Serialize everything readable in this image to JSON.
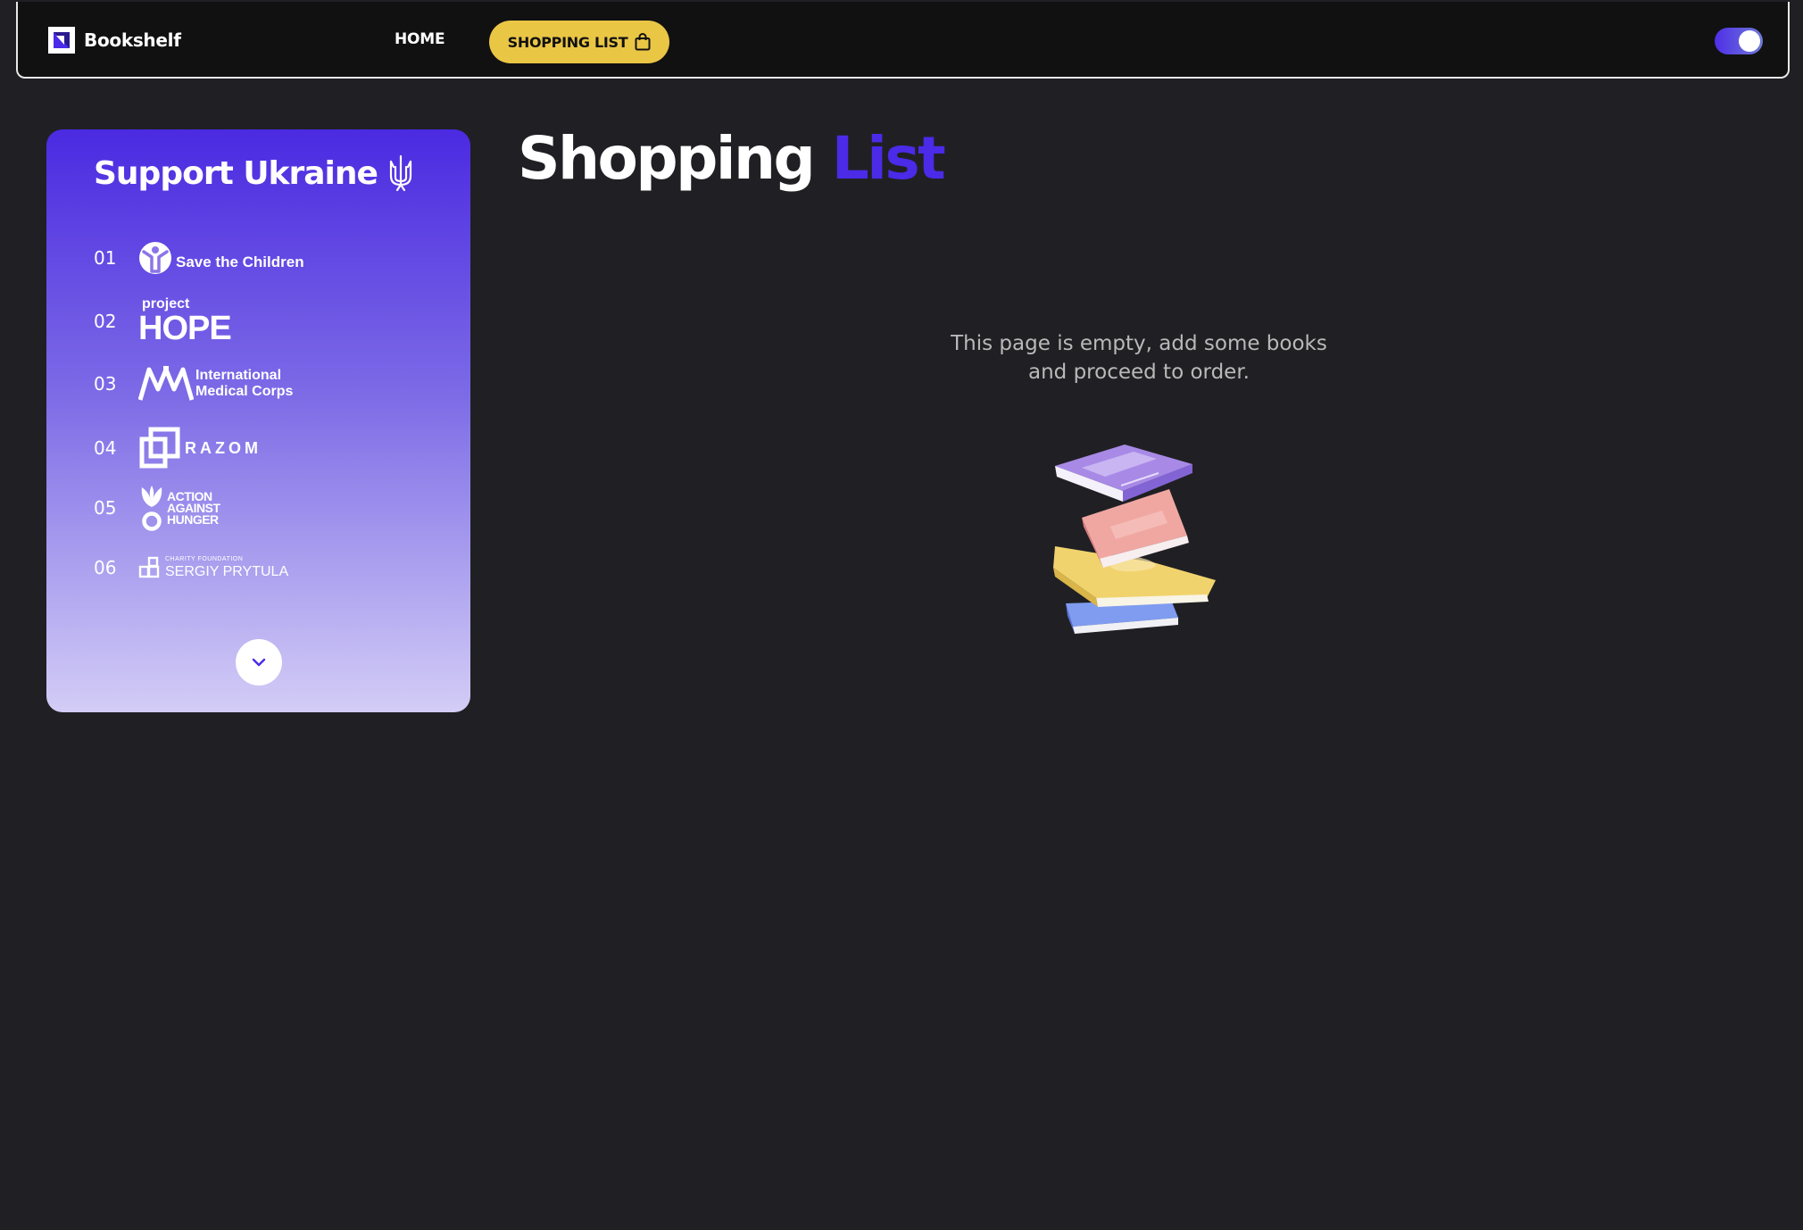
{
  "header": {
    "logo_text": "Bookshelf",
    "nav": {
      "home_label": "HOME",
      "shopping_list_label": "SHOPPING LIST"
    },
    "theme_toggle": {
      "state": "on",
      "accent_color": "#4f2ee8"
    }
  },
  "sidebar": {
    "title": "Support Ukraine",
    "title_icon": "trident-icon",
    "items": [
      {
        "number": "01",
        "name": "Save the Children",
        "icon": "child-figure-icon"
      },
      {
        "number": "02",
        "name": "Project HOPE",
        "logo_line1": "project",
        "logo_line2": "HOPE",
        "icon": "project-hope-logo"
      },
      {
        "number": "03",
        "name": "International Medical Corps",
        "logo_line1": "International",
        "logo_line2": "Medical Corps",
        "icon": "imc-logo"
      },
      {
        "number": "04",
        "name": "RAZOM",
        "icon": "razom-squares-icon"
      },
      {
        "number": "05",
        "name": "Action Against Hunger",
        "logo_line1": "ACTION",
        "logo_line2": "AGAINST",
        "logo_line3": "HUNGER",
        "icon": "action-against-hunger-logo"
      },
      {
        "number": "06",
        "name": "Sergiy Prytula Charity Foundation",
        "logo_line1": "CHARITY FOUNDATION",
        "logo_line2": "SERGIY PRYTULA",
        "icon": "prytula-logo"
      }
    ],
    "scroll_icon": "chevron-down-icon"
  },
  "main": {
    "title_part1": "Shopping",
    "title_part2": "List",
    "empty_text": "This page is empty, add some books and proceed to order.",
    "illustration": "stack-of-books-illustration"
  },
  "colors": {
    "background": "#202024",
    "header_bg": "#111111",
    "accent_purple": "#4b2ae8",
    "accent_yellow": "#eac645",
    "muted_text": "#b9b9b9"
  }
}
